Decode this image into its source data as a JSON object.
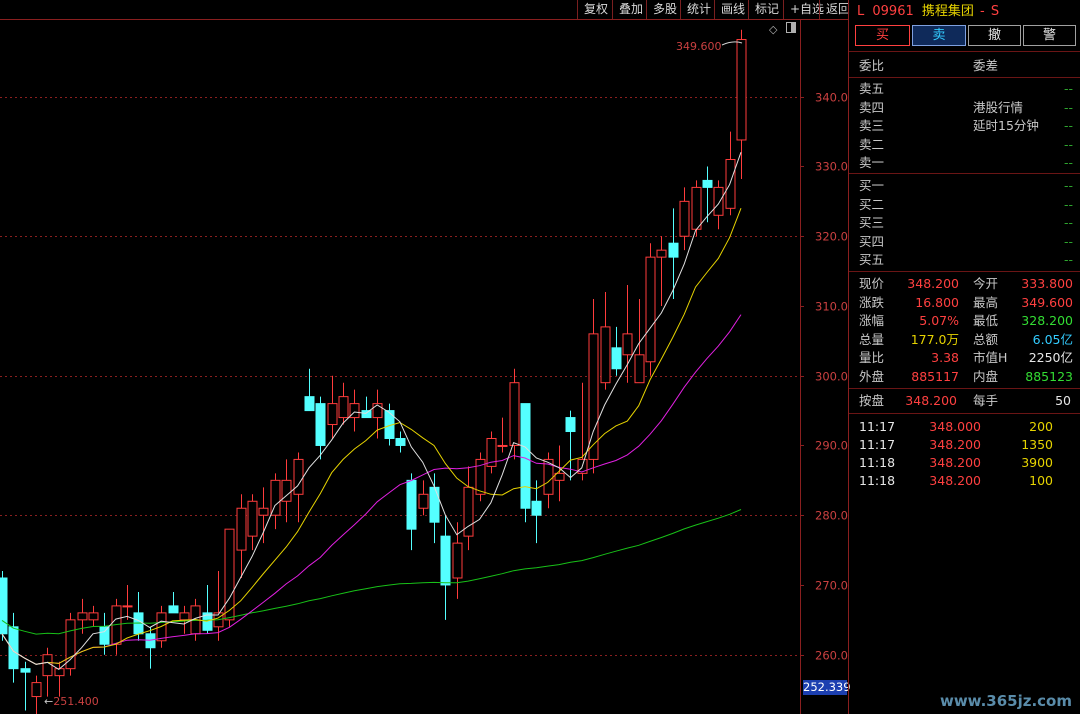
{
  "toolbar": [
    "复权",
    "叠加",
    "多股",
    "统计",
    "画线",
    "标记",
    "+自选",
    "返回"
  ],
  "header": {
    "prefix": "L",
    "code": "09961",
    "name": "携程集团",
    "suffix": "S"
  },
  "trade_buttons": [
    "买",
    "卖",
    "撤",
    "警"
  ],
  "order_book": {
    "ratio_label": "委比",
    "diff_label": "委差",
    "sells": [
      {
        "label": "卖五",
        "note": "",
        "value": "--"
      },
      {
        "label": "卖四",
        "note": "港股行情",
        "value": "--"
      },
      {
        "label": "卖三",
        "note": "延时15分钟",
        "value": "--"
      },
      {
        "label": "卖二",
        "note": "",
        "value": "--"
      },
      {
        "label": "卖一",
        "note": "",
        "value": "--"
      }
    ],
    "buys": [
      {
        "label": "买一",
        "value": "--"
      },
      {
        "label": "买二",
        "value": "--"
      },
      {
        "label": "买三",
        "value": "--"
      },
      {
        "label": "买四",
        "value": "--"
      },
      {
        "label": "买五",
        "value": "--"
      }
    ]
  },
  "quote": [
    {
      "l1": "现价",
      "v1": "348.200",
      "c1": "red",
      "l2": "今开",
      "v2": "333.800",
      "c2": "red"
    },
    {
      "l1": "涨跌",
      "v1": "16.800",
      "c1": "red",
      "l2": "最高",
      "v2": "349.600",
      "c2": "red"
    },
    {
      "l1": "涨幅",
      "v1": "5.07%",
      "c1": "red",
      "l2": "最低",
      "v2": "328.200",
      "c2": "green"
    },
    {
      "l1": "总量",
      "v1": "177.0万",
      "c1": "yellow",
      "l2": "总额",
      "v2": "6.05亿",
      "c2": "cyan"
    },
    {
      "l1": "量比",
      "v1": "3.38",
      "c1": "red",
      "l2": "市值H",
      "v2": "2250亿",
      "c2": "white"
    },
    {
      "l1": "外盘",
      "v1": "885117",
      "c1": "red",
      "l2": "内盘",
      "v2": "885123",
      "c2": "green"
    }
  ],
  "auction": {
    "l1": "按盘",
    "v1": "348.200",
    "l2": "每手",
    "v2": "50"
  },
  "ticks": [
    {
      "time": "11:17",
      "price": "348.000",
      "vol": "200"
    },
    {
      "time": "11:17",
      "price": "348.200",
      "vol": "1350"
    },
    {
      "time": "11:18",
      "price": "348.200",
      "vol": "3900"
    },
    {
      "time": "11:18",
      "price": "348.200",
      "vol": "100"
    }
  ],
  "watermark": "www.365jz.com",
  "colors": {
    "up": "#ff3c3c",
    "down": "#54ffff",
    "ma5": "#e0e0e0",
    "ma10": "#e6d300",
    "ma20": "#e020e0",
    "ma60": "#18c018",
    "grid": "#8a1f1f"
  },
  "chart_data": {
    "type": "candlestick",
    "y_ticks": [
      "340.0",
      "330.0",
      "320.0",
      "310.0",
      "300.0",
      "290.0",
      "280.0",
      "270.0",
      "260.0"
    ],
    "ylim": [
      251.5,
      351
    ],
    "high_label": "349.600",
    "low_label": "251.400",
    "current_label": "252.339",
    "candles": [
      {
        "o": 271,
        "h": 272,
        "l": 262,
        "c": 263
      },
      {
        "o": 264,
        "h": 266,
        "l": 256,
        "c": 258
      },
      {
        "o": 258,
        "h": 259,
        "l": 252,
        "c": 257.5
      },
      {
        "o": 254,
        "h": 257,
        "l": 251.4,
        "c": 256
      },
      {
        "o": 257,
        "h": 261,
        "l": 254,
        "c": 260
      },
      {
        "o": 257,
        "h": 259,
        "l": 254,
        "c": 258
      },
      {
        "o": 258,
        "h": 266,
        "l": 257,
        "c": 265
      },
      {
        "o": 265,
        "h": 268,
        "l": 263,
        "c": 266
      },
      {
        "o": 265,
        "h": 267,
        "l": 264,
        "c": 266
      },
      {
        "o": 264,
        "h": 266,
        "l": 260,
        "c": 261.5
      },
      {
        "o": 261.5,
        "h": 268,
        "l": 260,
        "c": 267
      },
      {
        "o": 267,
        "h": 270,
        "l": 265,
        "c": 267
      },
      {
        "o": 266,
        "h": 269,
        "l": 262,
        "c": 263
      },
      {
        "o": 263,
        "h": 264,
        "l": 258,
        "c": 261
      },
      {
        "o": 262,
        "h": 267,
        "l": 261,
        "c": 266
      },
      {
        "o": 267,
        "h": 269,
        "l": 266,
        "c": 266
      },
      {
        "o": 265,
        "h": 267,
        "l": 263,
        "c": 266
      },
      {
        "o": 263,
        "h": 268,
        "l": 262,
        "c": 267
      },
      {
        "o": 266,
        "h": 270,
        "l": 263,
        "c": 263.5
      },
      {
        "o": 264,
        "h": 272,
        "l": 262,
        "c": 266
      },
      {
        "o": 265,
        "h": 278,
        "l": 264,
        "c": 278
      },
      {
        "o": 275,
        "h": 283,
        "l": 271,
        "c": 281
      },
      {
        "o": 277,
        "h": 283,
        "l": 275,
        "c": 282
      },
      {
        "o": 280,
        "h": 284,
        "l": 276,
        "c": 281
      },
      {
        "o": 280,
        "h": 286,
        "l": 278,
        "c": 285
      },
      {
        "o": 282,
        "h": 288,
        "l": 279,
        "c": 285
      },
      {
        "o": 283,
        "h": 289,
        "l": 279,
        "c": 288
      },
      {
        "o": 297,
        "h": 301,
        "l": 295,
        "c": 295
      },
      {
        "o": 296,
        "h": 297,
        "l": 288,
        "c": 290
      },
      {
        "o": 293,
        "h": 300,
        "l": 291,
        "c": 296
      },
      {
        "o": 294,
        "h": 299,
        "l": 293,
        "c": 297
      },
      {
        "o": 294,
        "h": 298,
        "l": 292,
        "c": 296
      },
      {
        "o": 295,
        "h": 297,
        "l": 294,
        "c": 294
      },
      {
        "o": 294,
        "h": 298,
        "l": 291,
        "c": 296
      },
      {
        "o": 295,
        "h": 296,
        "l": 290,
        "c": 291
      },
      {
        "o": 291,
        "h": 292,
        "l": 289,
        "c": 290
      },
      {
        "o": 285,
        "h": 286,
        "l": 275,
        "c": 278
      },
      {
        "o": 281,
        "h": 285,
        "l": 280,
        "c": 283
      },
      {
        "o": 284,
        "h": 286,
        "l": 276,
        "c": 279
      },
      {
        "o": 277,
        "h": 280,
        "l": 265,
        "c": 270
      },
      {
        "o": 271,
        "h": 279,
        "l": 268,
        "c": 276
      },
      {
        "o": 277,
        "h": 287,
        "l": 275,
        "c": 284
      },
      {
        "o": 283,
        "h": 289,
        "l": 282,
        "c": 288
      },
      {
        "o": 287,
        "h": 292,
        "l": 286,
        "c": 291
      },
      {
        "o": 290,
        "h": 294,
        "l": 289,
        "c": 290
      },
      {
        "o": 290,
        "h": 301,
        "l": 288,
        "c": 299
      },
      {
        "o": 296,
        "h": 296,
        "l": 279,
        "c": 281
      },
      {
        "o": 282,
        "h": 285,
        "l": 276,
        "c": 280
      },
      {
        "o": 283,
        "h": 289,
        "l": 281,
        "c": 288
      },
      {
        "o": 285,
        "h": 290,
        "l": 282,
        "c": 286
      },
      {
        "o": 294,
        "h": 295,
        "l": 285,
        "c": 292
      },
      {
        "o": 286,
        "h": 299,
        "l": 285,
        "c": 288
      },
      {
        "o": 288,
        "h": 311,
        "l": 286,
        "c": 306
      },
      {
        "o": 299,
        "h": 312,
        "l": 298,
        "c": 307
      },
      {
        "o": 304,
        "h": 307,
        "l": 300,
        "c": 301
      },
      {
        "o": 303,
        "h": 313,
        "l": 299,
        "c": 306
      },
      {
        "o": 299,
        "h": 311,
        "l": 299,
        "c": 303
      },
      {
        "o": 302,
        "h": 319,
        "l": 300,
        "c": 317
      },
      {
        "o": 317,
        "h": 320,
        "l": 310,
        "c": 318
      },
      {
        "o": 319,
        "h": 324,
        "l": 311,
        "c": 317
      },
      {
        "o": 320,
        "h": 327,
        "l": 318,
        "c": 325
      },
      {
        "o": 321,
        "h": 328,
        "l": 320,
        "c": 327
      },
      {
        "o": 328,
        "h": 330,
        "l": 322,
        "c": 327
      },
      {
        "o": 323,
        "h": 328,
        "l": 321,
        "c": 327
      },
      {
        "o": 324,
        "h": 335,
        "l": 323,
        "c": 331
      },
      {
        "o": 333.8,
        "h": 349.6,
        "l": 328.2,
        "c": 348.2
      }
    ]
  }
}
